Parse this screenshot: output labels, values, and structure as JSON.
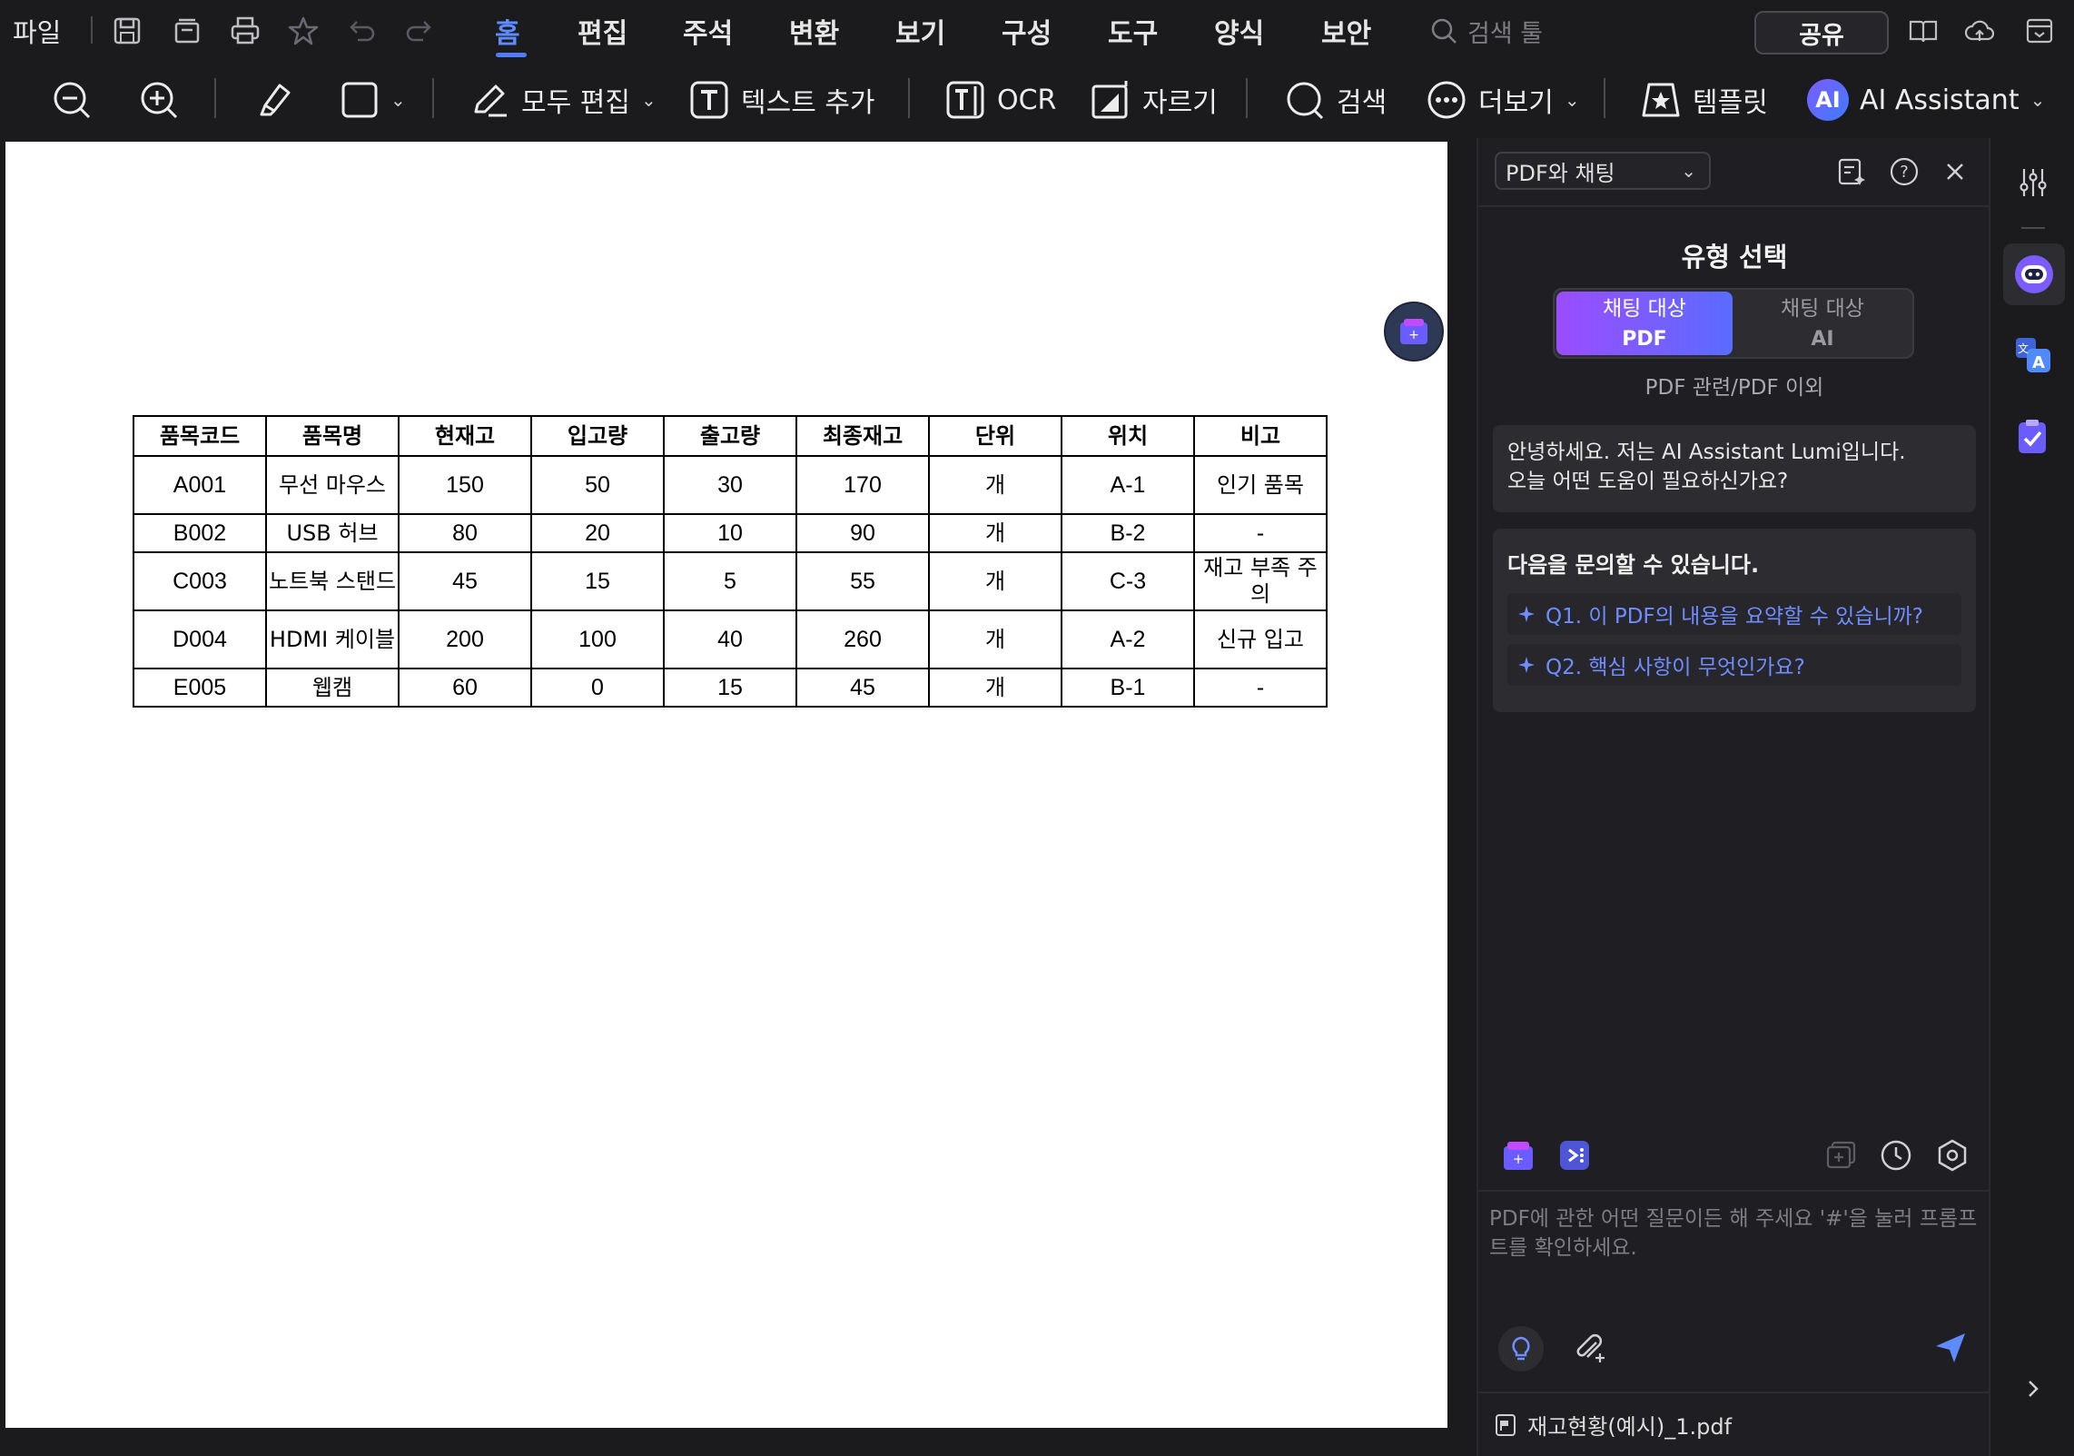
{
  "menu": {
    "file": "파일",
    "tabs": [
      "홈",
      "편집",
      "주석",
      "변환",
      "보기",
      "구성",
      "도구",
      "양식",
      "보안"
    ],
    "active_tab": "홈",
    "search_placeholder": "검색 툴",
    "share": "공유"
  },
  "toolbar": {
    "edit_all": "모두 편집",
    "add_text": "텍스트 추가",
    "ocr": "OCR",
    "crop": "자르기",
    "search": "검색",
    "more": "더보기",
    "template": "템플릿",
    "ai_badge": "AI",
    "ai_assistant": "AI Assistant"
  },
  "document": {
    "headers": [
      "품목코드",
      "품목명",
      "현재고",
      "입고량",
      "출고량",
      "최종재고",
      "단위",
      "위치",
      "비고"
    ],
    "rows": [
      [
        "A001",
        "무선 마우스",
        "150",
        "50",
        "30",
        "170",
        "개",
        "A-1",
        "인기 품목"
      ],
      [
        "B002",
        "USB 허브",
        "80",
        "20",
        "10",
        "90",
        "개",
        "B-2",
        "-"
      ],
      [
        "C003",
        "노트북 스탠드",
        "45",
        "15",
        "5",
        "55",
        "개",
        "C-3",
        "재고 부족 주의"
      ],
      [
        "D004",
        "HDMI 케이블",
        "200",
        "100",
        "40",
        "260",
        "개",
        "A-2",
        "신규 입고"
      ],
      [
        "E005",
        "웹캠",
        "60",
        "0",
        "15",
        "45",
        "개",
        "B-1",
        "-"
      ]
    ]
  },
  "panel": {
    "mode": "PDF와 채팅",
    "type_title": "유형 선택",
    "seg_pdf_line1": "채팅 대상",
    "seg_pdf_line2": "PDF",
    "seg_ai_line1": "채팅 대상",
    "seg_ai_line2": "AI",
    "seg_sub": "PDF 관련/PDF 이외",
    "greeting_line1": "안녕하세요. 저는 AI Assistant Lumi입니다.",
    "greeting_line2": "오늘 어떤 도움이 필요하신가요?",
    "suggest_title": "다음을 문의할 수 있습니다.",
    "questions": [
      "Q1. 이 PDF의 내용을 요약할 수 있습니까?",
      "Q2. 핵심 사항이 무엇인가요?"
    ],
    "input_placeholder": "PDF에 관한 어떤 질문이든 해 주세요 '#'을 눌러 프롬프트를 확인하세요.",
    "file_name": "재고현황(예시)_1.pdf"
  },
  "colors": {
    "accent": "#4f7dff",
    "question_text": "#6f8dff",
    "page_bg": "#ffffff",
    "app_bg": "#1b1b1e"
  }
}
